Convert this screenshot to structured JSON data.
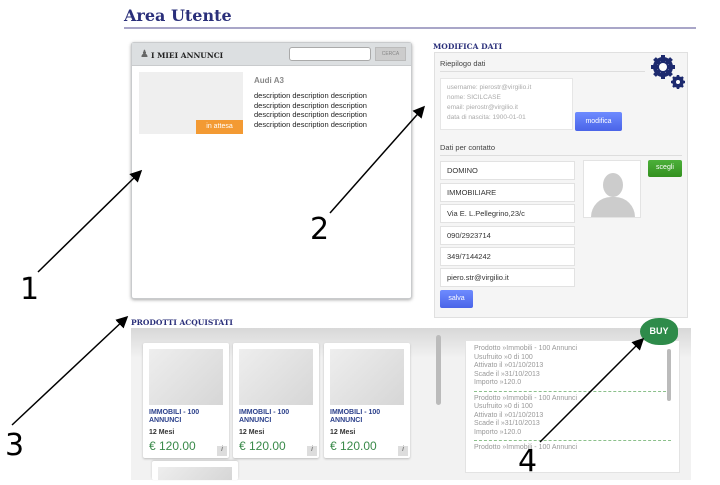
{
  "page": {
    "title": "Area Utente"
  },
  "annunci": {
    "heading": "I MIEI ANNUNCI",
    "search_placeholder": "",
    "search_button": "CERCA",
    "item": {
      "title": "Audi A3",
      "status": "in attesa",
      "description": [
        "description description description",
        "description description description",
        "description description description",
        "description description description"
      ]
    }
  },
  "modifica": {
    "heading": "MODIFICA DATI",
    "riepilogo_label": "Riepilogo dati",
    "summary": [
      "username: pierostr@virgilio.it",
      "nome: SICILCASE",
      "email: pierostr@virgilio.it",
      "data di nascita: 1900-01-01"
    ],
    "modifica_button": "modifica",
    "contatto_label": "Dati per contatto",
    "fields": [
      "DOMINO",
      "IMMOBILIARE",
      "Via E. L.Pellegrino,23/c",
      "090/2923714",
      "349/7144242",
      "piero.str@virgilio.it"
    ],
    "scegli_button": "scegli",
    "salva_button": "salva"
  },
  "prodotti": {
    "heading": "PRODOTTI ACQUISTATI",
    "buy_label": "BUY",
    "cards": [
      {
        "name": "IMMOBILI - 100 ANNUNCI",
        "duration": "12 Mesi",
        "price": "€ 120.00",
        "info": "i"
      },
      {
        "name": "IMMOBILI - 100 ANNUNCI",
        "duration": "12 Mesi",
        "price": "€ 120.00",
        "info": "i"
      },
      {
        "name": "IMMOBILI - 100 ANNUNCI",
        "duration": "12 Mesi",
        "price": "€ 120.00",
        "info": "i"
      }
    ],
    "history": [
      {
        "prodotto": "Prodotto »Immobili - 100 Annunci",
        "usufruito": "Usufruito »0 di 100",
        "attivato": "Attivato il »01/10/2013",
        "scade": "Scade il »31/10/2013",
        "importo": "Importo »120.0"
      },
      {
        "prodotto": "Prodotto »Immobili - 100 Annunci",
        "usufruito": "Usufruito »0 di 100",
        "attivato": "Attivato il »01/10/2013",
        "scade": "Scade il »31/10/2013",
        "importo": "Importo »120.0"
      },
      {
        "prodotto": "Prodotto »Immobili - 100 Annunci"
      }
    ]
  },
  "annotations": [
    "1",
    "2",
    "3",
    "4"
  ],
  "colors": {
    "brand": "#2a2f7a",
    "pending": "#f39a33",
    "buy": "#2e8b4a",
    "primary_button": "#4a64e8",
    "choose_button": "#3a9a2a"
  }
}
